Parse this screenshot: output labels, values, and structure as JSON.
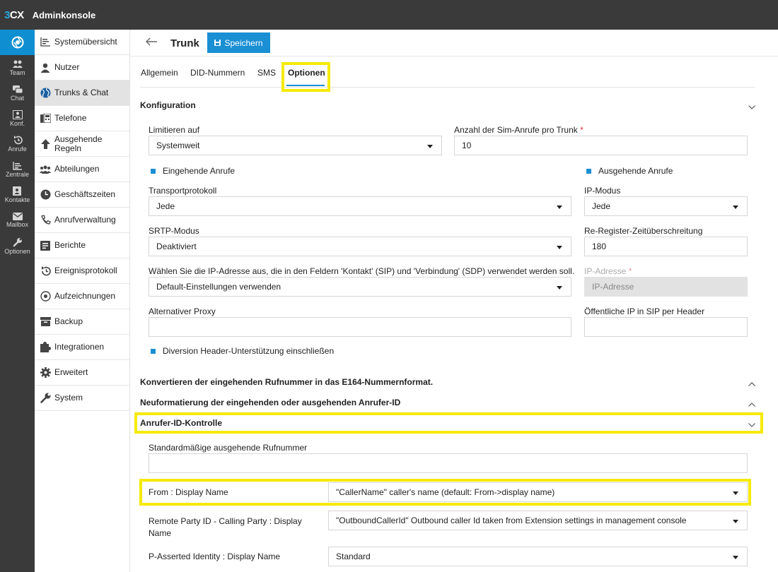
{
  "app": {
    "logo_3": "3",
    "logo_cx": "CX",
    "title": "Adminkonsole"
  },
  "rail": [
    {
      "label": "Team",
      "icon": "team-icon"
    },
    {
      "label": "Chat",
      "icon": "chat-icon"
    },
    {
      "label": "Konf.",
      "icon": "conference-icon"
    },
    {
      "label": "Anrufe",
      "icon": "calls-icon"
    },
    {
      "label": "Zentrale",
      "icon": "switchboard-icon"
    },
    {
      "label": "Kontakte",
      "icon": "contacts-icon"
    },
    {
      "label": "Mailbox",
      "icon": "mailbox-icon"
    },
    {
      "label": "Optionen",
      "icon": "options-icon"
    }
  ],
  "nav": [
    {
      "label": "Systemübersicht",
      "icon": "dashboard-icon"
    },
    {
      "label": "Nutzer",
      "icon": "user-icon"
    },
    {
      "label": "Trunks & Chat",
      "icon": "globe-icon",
      "active": true
    },
    {
      "label": "Telefone",
      "icon": "phone-icon"
    },
    {
      "label": "Ausgehende Regeln",
      "icon": "arrow-up-icon"
    },
    {
      "label": "Abteilungen",
      "icon": "group-icon"
    },
    {
      "label": "Geschäftszeiten",
      "icon": "clock-icon"
    },
    {
      "label": "Anrufverwaltung",
      "icon": "call-handling-icon"
    },
    {
      "label": "Berichte",
      "icon": "report-icon"
    },
    {
      "label": "Ereignisprotokoll",
      "icon": "event-log-icon"
    },
    {
      "label": "Aufzeichnungen",
      "icon": "record-icon"
    },
    {
      "label": "Backup",
      "icon": "archive-icon"
    },
    {
      "label": "Integrationen",
      "icon": "puzzle-icon"
    },
    {
      "label": "Erweitert",
      "icon": "cog-icon"
    },
    {
      "label": "System",
      "icon": "wrench-icon"
    }
  ],
  "page": {
    "title": "Trunk",
    "save_label": "Speichern"
  },
  "tabs": [
    "Allgemein",
    "DID-Nummern",
    "SMS",
    "Optionen"
  ],
  "config": {
    "heading": "Konfiguration",
    "limit_label": "Limitieren auf",
    "limit_value": "Systemweit",
    "sim_calls_label": "Anzahl der Sim-Anrufe pro Trunk",
    "sim_calls_value": "10",
    "inbound_label": "Eingehende Anrufe",
    "outbound_label": "Ausgehende Anrufe",
    "transport_label": "Transportprotokoll",
    "transport_value": "Jede",
    "ip_mode_label": "IP-Modus",
    "ip_mode_value": "Jede",
    "srtp_label": "SRTP-Modus",
    "srtp_value": "Deaktiviert",
    "reregister_label": "Re-Register-Zeitüberschreitung",
    "reregister_value": "180",
    "ip_choice_label": "Wählen Sie die IP-Adresse aus, die in den Feldern 'Kontakt' (SIP) und 'Verbindung' (SDP) verwendet werden soll.",
    "ip_choice_value": "Default-Einstellungen verwenden",
    "ip_address_label": "IP-Adresse",
    "ip_address_placeholder": "IP-Adresse",
    "alt_proxy_label": "Alternativer Proxy",
    "alt_proxy_value": "",
    "public_ip_label": "Öffentliche IP in SIP per Header",
    "public_ip_value": "",
    "diversion_label": "Diversion Header-Unterstützung einschließen",
    "required_mark": "*"
  },
  "sections": {
    "e164": "Konvertieren der eingehenden Rufnummer in das E164-Nummernformat.",
    "reformat": "Neuformatierung der eingehenden oder ausgehenden Anrufer-ID",
    "callerid": "Anrufer-ID-Kontrolle"
  },
  "callerid": {
    "default_out_label": "Standardmäßige ausgehende Rufnummer",
    "default_out_value": "",
    "from_display_label": "From : Display Name",
    "from_display_value": "\"CallerName\" caller's name (default: From->display name)",
    "remote_party_label": "Remote Party ID - Calling Party : Display Name",
    "remote_party_value": "\"OutboundCallerId\" Outbound caller Id taken from Extension settings in management console",
    "passerted_label": "P-Asserted Identity : Display Name",
    "passerted_value": "Standard"
  },
  "colors": {
    "accent": "#1a8fd4",
    "highlight": "#f5ea00",
    "sidebar_dark": "#3a3a3a",
    "nav_active": "#e3e3e3"
  }
}
